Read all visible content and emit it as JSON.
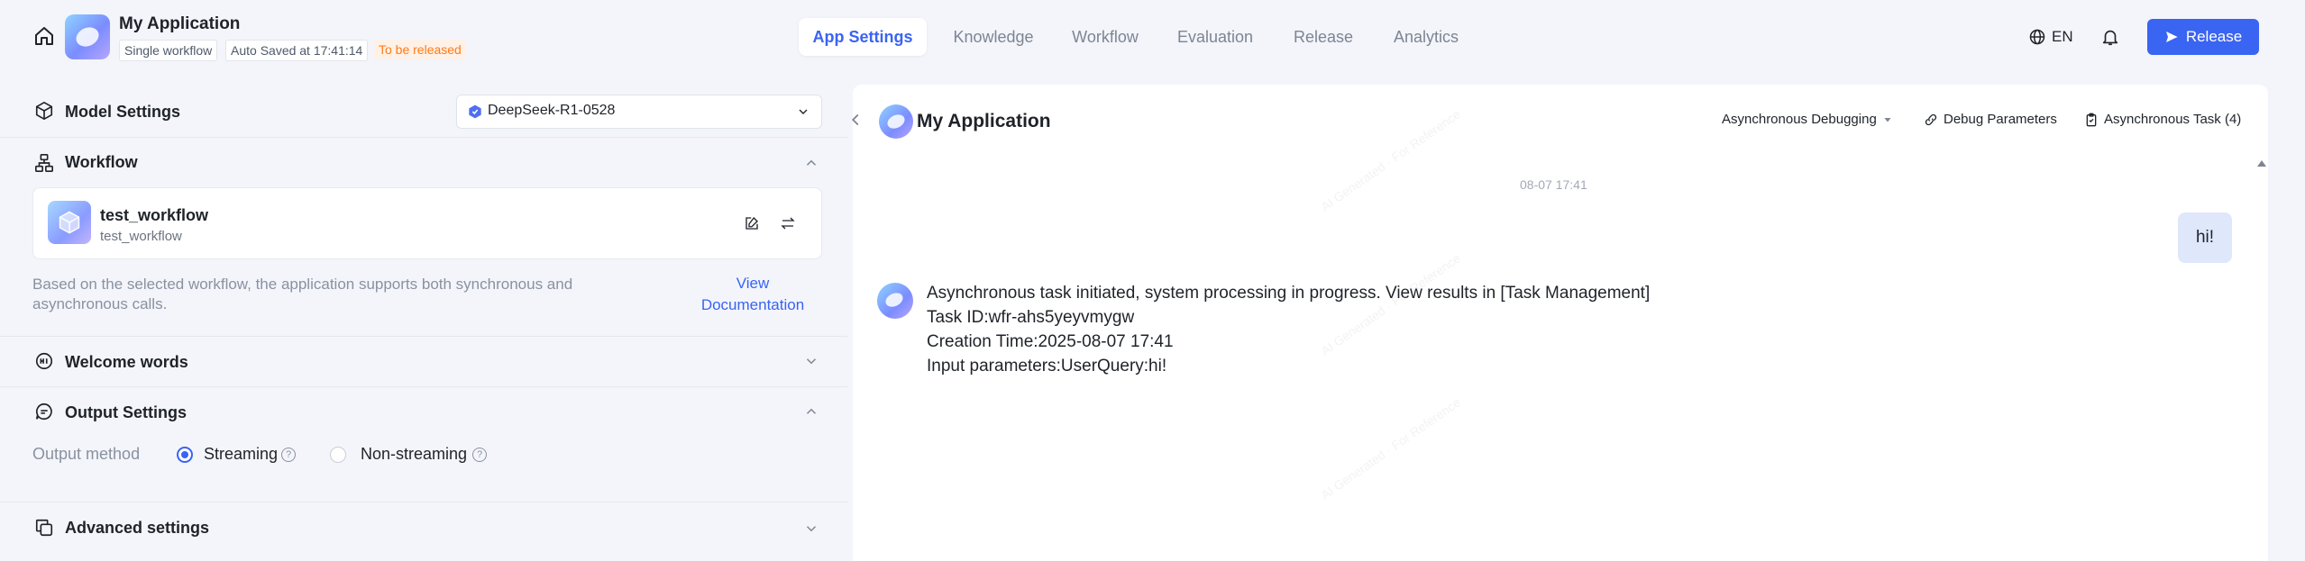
{
  "header": {
    "app_title": "My Application",
    "tag_workflow": "Single workflow",
    "tag_saved": "Auto Saved at 17:41:14",
    "tag_status": "To be released",
    "tabs": [
      {
        "label": "App Settings",
        "active": true
      },
      {
        "label": "Knowledge",
        "active": false
      },
      {
        "label": "Workflow",
        "active": false
      },
      {
        "label": "Evaluation",
        "active": false
      },
      {
        "label": "Release",
        "active": false
      },
      {
        "label": "Analytics",
        "active": false
      }
    ],
    "language": "EN",
    "release_button": "Release"
  },
  "left": {
    "model_settings": {
      "title": "Model Settings",
      "selected_model": "DeepSeek-R1-0528"
    },
    "workflow": {
      "title": "Workflow",
      "card_name": "test_workflow",
      "card_sub": "test_workflow",
      "description_line1": "Based on the selected workflow, the application supports both synchronous and",
      "description_line2": "asynchronous calls.",
      "doc_link_line1": "View",
      "doc_link_line2": "Documentation"
    },
    "welcome": {
      "title": "Welcome words"
    },
    "output": {
      "title": "Output Settings",
      "method_label": "Output method",
      "options": [
        {
          "label": "Streaming",
          "selected": true
        },
        {
          "label": "Non-streaming",
          "selected": false
        }
      ]
    },
    "advanced": {
      "title": "Advanced settings"
    }
  },
  "right": {
    "title": "My Application",
    "debug_mode": "Asynchronous Debugging",
    "debug_params": "Debug Parameters",
    "async_task": "Asynchronous Task (4)",
    "timestamp": "08-07 17:41",
    "user_message": "hi!",
    "bot_message": [
      "Asynchronous task initiated, system processing in progress. View results in [Task Management]",
      "Task ID:wfr-ahs5yeyvmygw",
      "Creation Time:2025-08-07 17:41",
      "Input parameters:UserQuery:hi!"
    ],
    "watermark_text": "AI Generated · For Reference"
  },
  "colors": {
    "accent": "#3a64f2",
    "status_orange": "#ff7a1a",
    "page_bg": "#f3f5fb",
    "user_bubble": "#dfe7fb"
  },
  "icons": [
    "home-icon",
    "globe-icon",
    "bell-icon",
    "send-icon",
    "cube-icon",
    "workflow-icon",
    "welcome-icon",
    "chat-icon",
    "copy-icon",
    "chevron-up-icon",
    "chevron-down-icon",
    "edit-icon",
    "swap-icon",
    "link-icon",
    "clipboard-icon",
    "collapse-left-icon",
    "help-icon"
  ]
}
